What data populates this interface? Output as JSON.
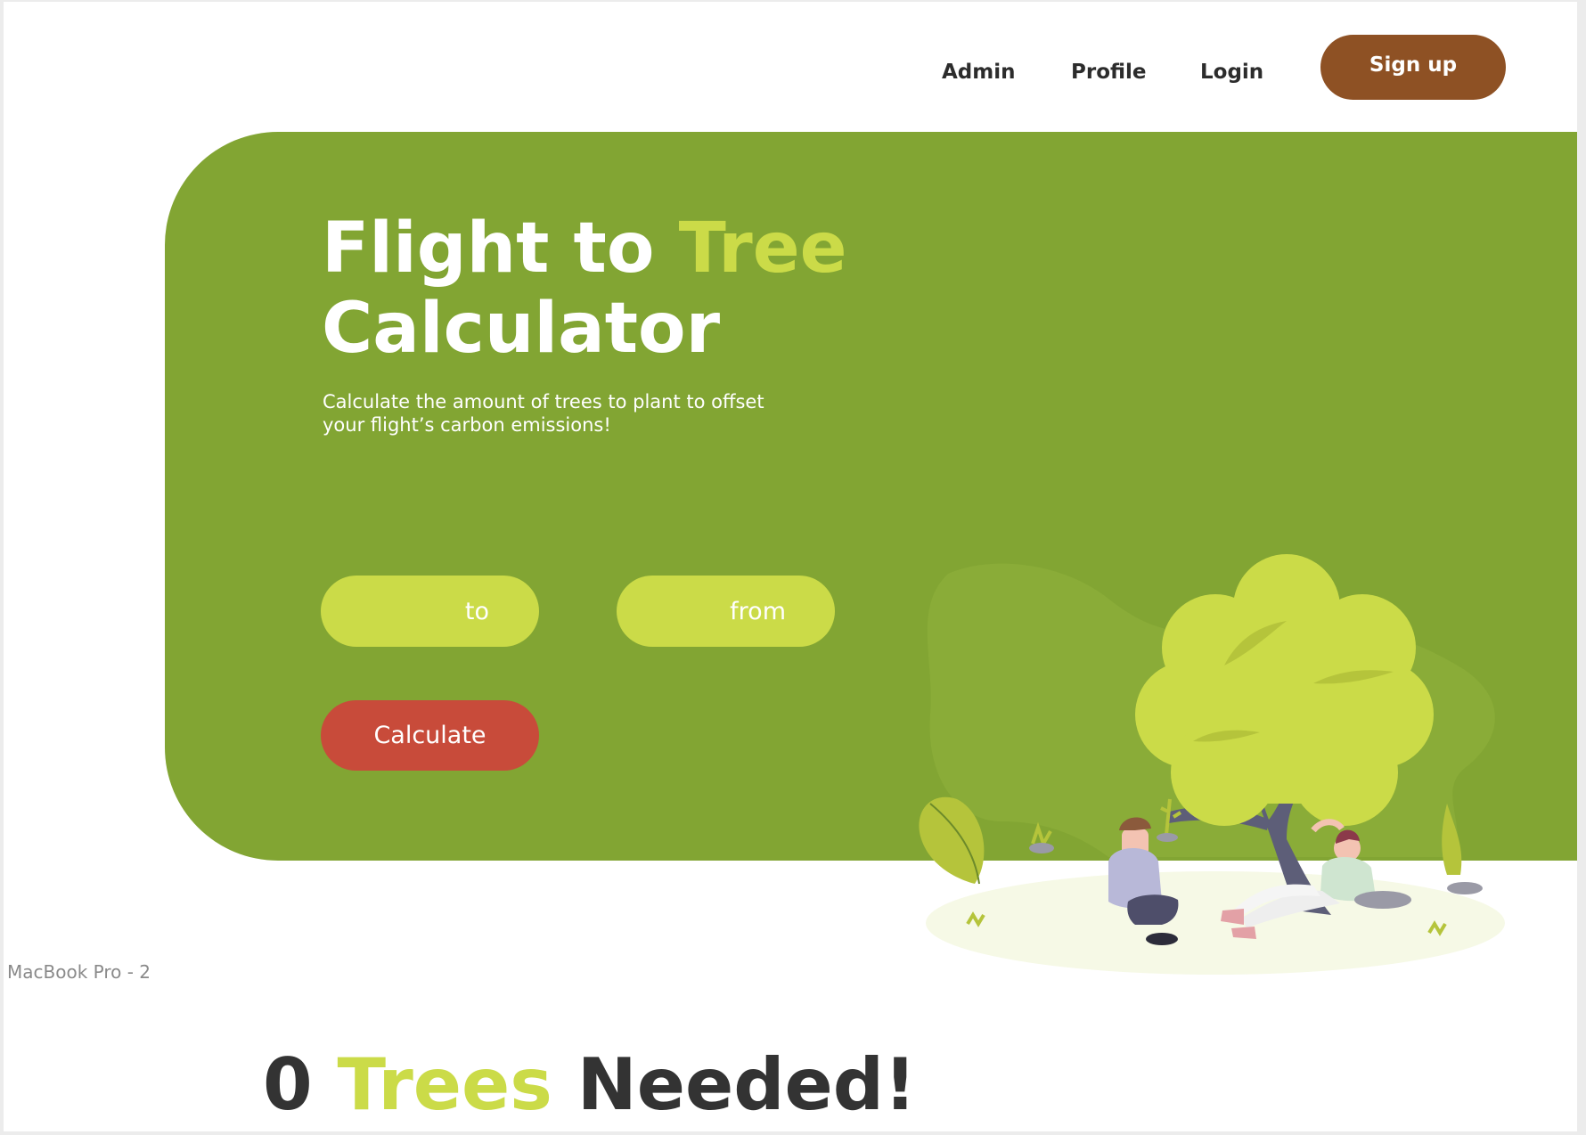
{
  "nav": {
    "admin": "Admin",
    "profile": "Profile",
    "login": "Login",
    "signup": "Sign up"
  },
  "hero": {
    "title_part1": "Flight to ",
    "title_accent": "Tree",
    "title_line2": "Calculator",
    "subtitle": "Calculate the amount of trees to plant to offset your flight’s carbon emissions!",
    "to_placeholder": "to",
    "from_placeholder": "from",
    "calculate_label": "Calculate"
  },
  "frame_label": "MacBook Pro - 2",
  "result": {
    "count": "0",
    "accent_word": "Trees",
    "suffix": "Needed!"
  },
  "colors": {
    "hero_bg": "#82a533",
    "accent_lime": "#cbdb48",
    "signup_brown": "#8e5124",
    "calculate_red": "#c84b3a",
    "text_dark": "#333333"
  }
}
